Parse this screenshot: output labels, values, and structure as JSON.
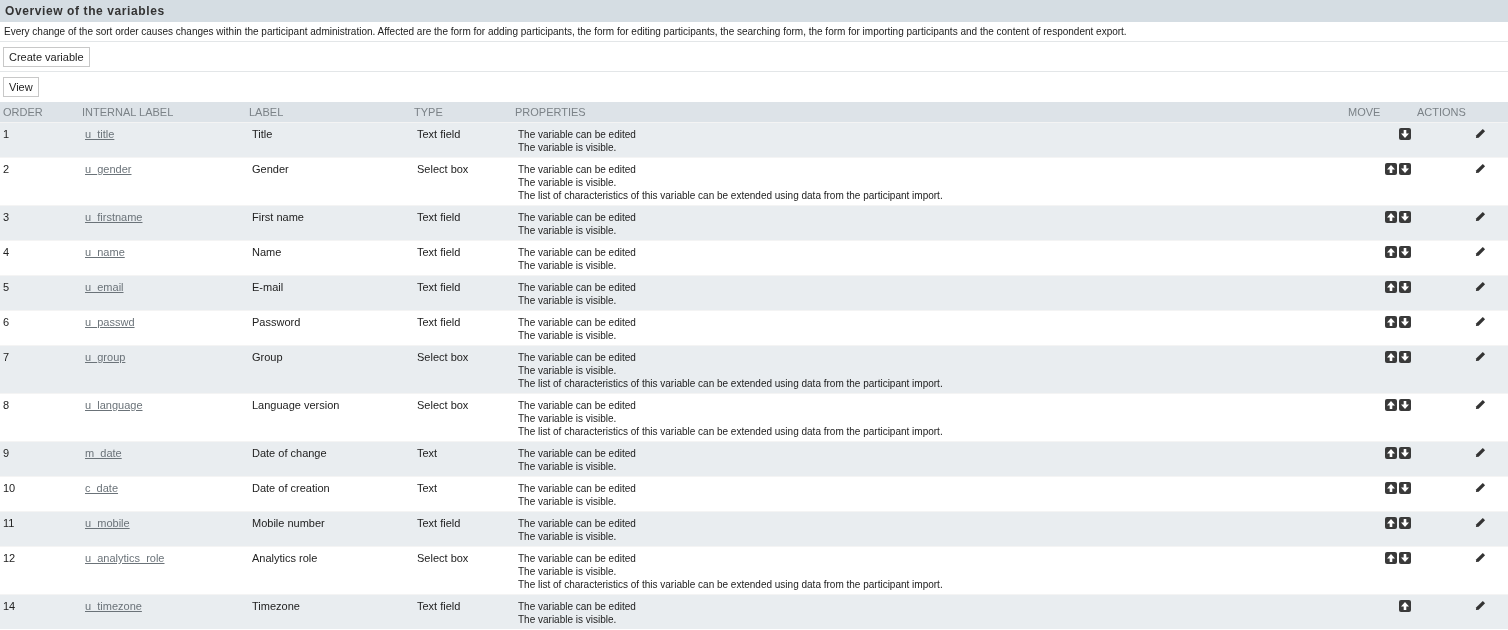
{
  "title": "Overview of the variables",
  "description": "Every change of the sort order causes changes within the participant administration. Affected are the form for adding participants, the form for editing participants, the searching form, the form for importing participants and the content of respondent export.",
  "buttons": {
    "create": "Create variable",
    "view": "View"
  },
  "table": {
    "columns": [
      "ORDER",
      "INTERNAL LABEL",
      "LABEL",
      "TYPE",
      "PROPERTIES",
      "MOVE",
      "ACTIONS"
    ],
    "rows": [
      {
        "order": "1",
        "internal_label": "u_title",
        "label": "Title",
        "type": "Text field",
        "properties": [
          "The variable can be edited",
          "The variable is visible."
        ],
        "move_up": false,
        "move_down": true
      },
      {
        "order": "2",
        "internal_label": "u_gender",
        "label": "Gender",
        "type": "Select box",
        "properties": [
          "The variable can be edited",
          "The variable is visible.",
          "The list of characteristics of this variable can be extended using data from the participant import."
        ],
        "move_up": true,
        "move_down": true
      },
      {
        "order": "3",
        "internal_label": "u_firstname",
        "label": "First name",
        "type": "Text field",
        "properties": [
          "The variable can be edited",
          "The variable is visible."
        ],
        "move_up": true,
        "move_down": true
      },
      {
        "order": "4",
        "internal_label": "u_name",
        "label": "Name",
        "type": "Text field",
        "properties": [
          "The variable can be edited",
          "The variable is visible."
        ],
        "move_up": true,
        "move_down": true
      },
      {
        "order": "5",
        "internal_label": "u_email",
        "label": "E-mail",
        "type": "Text field",
        "properties": [
          "The variable can be edited",
          "The variable is visible."
        ],
        "move_up": true,
        "move_down": true
      },
      {
        "order": "6",
        "internal_label": "u_passwd",
        "label": "Password",
        "type": "Text field",
        "properties": [
          "The variable can be edited",
          "The variable is visible."
        ],
        "move_up": true,
        "move_down": true
      },
      {
        "order": "7",
        "internal_label": "u_group",
        "label": "Group",
        "type": "Select box",
        "properties": [
          "The variable can be edited",
          "The variable is visible.",
          "The list of characteristics of this variable can be extended using data from the participant import."
        ],
        "move_up": true,
        "move_down": true
      },
      {
        "order": "8",
        "internal_label": "u_language",
        "label": "Language version",
        "type": "Select box",
        "properties": [
          "The variable can be edited",
          "The variable is visible.",
          "The list of characteristics of this variable can be extended using data from the participant import."
        ],
        "move_up": true,
        "move_down": true
      },
      {
        "order": "9",
        "internal_label": "m_date",
        "label": "Date of change",
        "type": "Text",
        "properties": [
          "The variable can be edited",
          "The variable is visible."
        ],
        "move_up": true,
        "move_down": true
      },
      {
        "order": "10",
        "internal_label": "c_date",
        "label": "Date of creation",
        "type": "Text",
        "properties": [
          "The variable can be edited",
          "The variable is visible."
        ],
        "move_up": true,
        "move_down": true
      },
      {
        "order": "11",
        "internal_label": "u_mobile",
        "label": "Mobile number",
        "type": "Text field",
        "properties": [
          "The variable can be edited",
          "The variable is visible."
        ],
        "move_up": true,
        "move_down": true
      },
      {
        "order": "12",
        "internal_label": "u_analytics_role",
        "label": "Analytics role",
        "type": "Select box",
        "properties": [
          "The variable can be edited",
          "The variable is visible.",
          "The list of characteristics of this variable can be extended using data from the participant import."
        ],
        "move_up": true,
        "move_down": true
      },
      {
        "order": "14",
        "internal_label": "u_timezone",
        "label": "Timezone",
        "type": "Text field",
        "properties": [
          "The variable can be edited",
          "The variable is visible."
        ],
        "move_up": true,
        "move_down": false
      }
    ]
  }
}
